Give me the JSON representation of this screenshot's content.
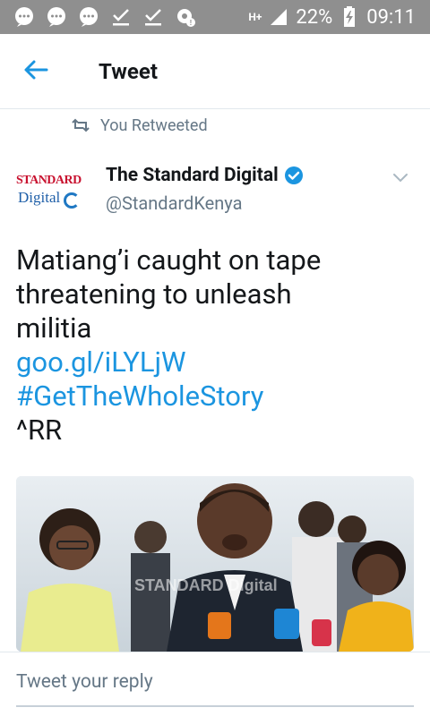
{
  "status_bar": {
    "network": "H+",
    "battery_percent": "22%",
    "time": "09:11",
    "left_icons": [
      "chat-bubble-icon",
      "chat-bubble-icon",
      "chat-bubble-icon",
      "check-download-icon",
      "check-download-icon",
      "gear-notification-icon"
    ]
  },
  "header": {
    "back_icon": "arrow-left-icon",
    "title": "Tweet"
  },
  "tweet": {
    "retweet_context": "You Retweeted",
    "author": {
      "avatar_logo_top": "STANDARD",
      "avatar_logo_bottom": "Digital",
      "name": "The Standard Digital",
      "verified": true,
      "handle": "@StandardKenya"
    },
    "text_lines": [
      "Matiang’i caught on tape",
      "threatening to unleash",
      "militia"
    ],
    "link": "goo.gl/iLYLjW",
    "hashtag": "#GetTheWholeStory",
    "signature": "^RR",
    "media_watermark": "STANDARD Digital"
  },
  "reply": {
    "placeholder": "Tweet your reply"
  },
  "colors": {
    "status_bar": "#8f8f8f",
    "accent": "#1b95e0",
    "text_primary": "#14171a",
    "text_secondary": "#657786"
  }
}
